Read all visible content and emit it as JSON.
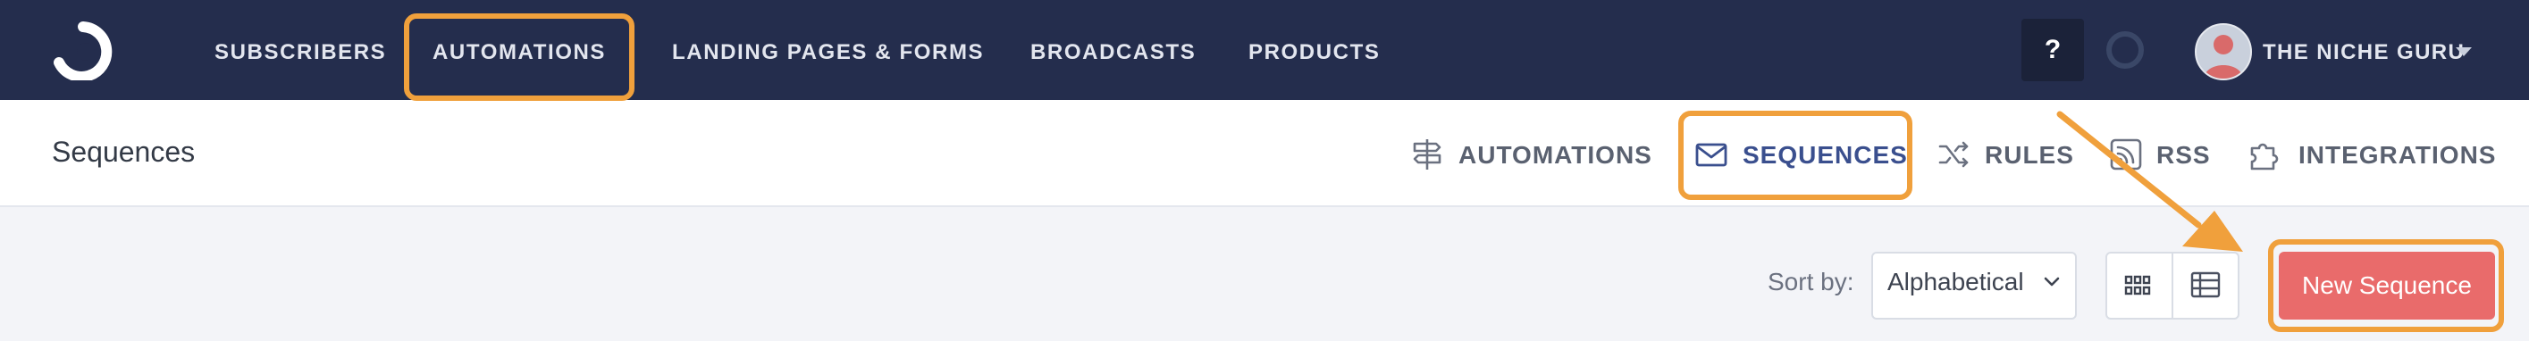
{
  "topnav": {
    "items": [
      {
        "label": "SUBSCRIBERS"
      },
      {
        "label": "AUTOMATIONS"
      },
      {
        "label": "LANDING PAGES & FORMS"
      },
      {
        "label": "BROADCASTS"
      },
      {
        "label": "PRODUCTS"
      }
    ],
    "help_label": "?",
    "account_name": "THE NICHE GURU"
  },
  "subnav": {
    "page_title": "Sequences",
    "items": [
      {
        "label": "AUTOMATIONS",
        "icon": "signpost-icon"
      },
      {
        "label": "SEQUENCES",
        "icon": "envelope-icon",
        "active": true
      },
      {
        "label": "RULES",
        "icon": "shuffle-icon"
      },
      {
        "label": "RSS",
        "icon": "rss-icon"
      },
      {
        "label": "INTEGRATIONS",
        "icon": "puzzle-icon"
      }
    ]
  },
  "toolbar": {
    "sort_label": "Sort by:",
    "sort_value": "Alphabetical",
    "new_button": "New Sequence"
  },
  "colors": {
    "nav_bg": "#242d4d",
    "accent_active": "#3a4f8e",
    "primary_button": "#e96b6b",
    "annotation": "#f0a03c"
  }
}
